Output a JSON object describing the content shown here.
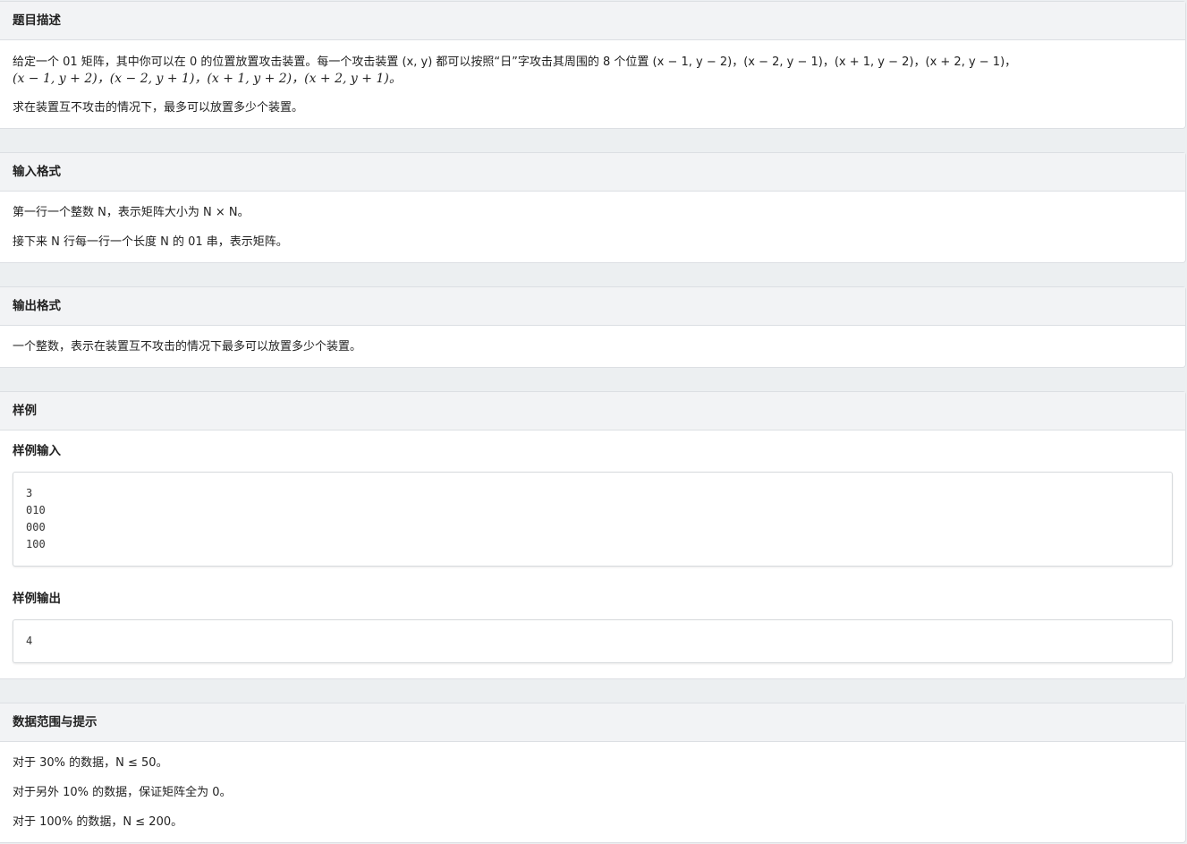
{
  "description": {
    "title": "题目描述",
    "line1": "给定一个 01 矩阵，其中你可以在 0 的位置放置攻击装置。每一个攻击装置 (x, y) 都可以按照“日”字攻击其周围的 8 个位置 (x − 1, y − 2)，(x − 2, y − 1)，(x + 1, y − 2)，(x + 2, y − 1)，",
    "line2": "(x − 1, y + 2)，(x − 2, y + 1)，(x + 1, y + 2)，(x + 2, y + 1)。",
    "line3": "求在装置互不攻击的情况下，最多可以放置多少个装置。"
  },
  "input_format": {
    "title": "输入格式",
    "line1": "第一行一个整数 N，表示矩阵大小为 N × N。",
    "line2": "接下来 N 行每一行一个长度 N 的 01 串，表示矩阵。"
  },
  "output_format": {
    "title": "输出格式",
    "line1": "一个整数，表示在装置互不攻击的情况下最多可以放置多少个装置。"
  },
  "sample": {
    "title": "样例",
    "input_label": "样例输入",
    "input_lines": [
      "3",
      "010",
      "000",
      "100"
    ],
    "output_label": "样例输出",
    "output_lines": [
      "4"
    ]
  },
  "constraints": {
    "title": "数据范围与提示",
    "line1": "对于 30% 的数据，N ≤ 50。",
    "line2": "对于另外 10% 的数据，保证矩阵全为 0。",
    "line3": "对于 100% 的数据，N ≤ 200。"
  }
}
